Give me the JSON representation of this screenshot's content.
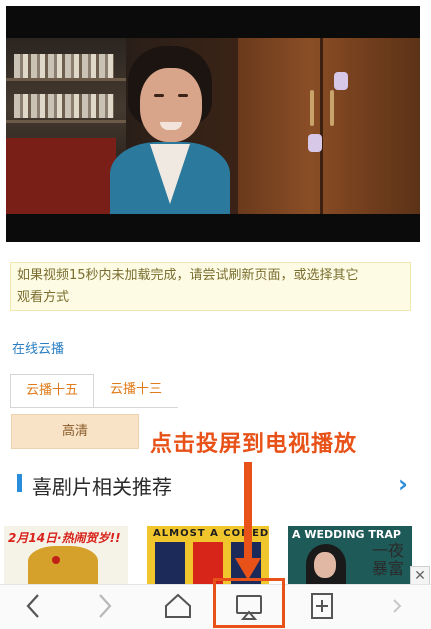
{
  "notice": {
    "line1": "如果视频15秒内未加载完成，请尝试刷新页面，或选择其它",
    "line2": "观看方式"
  },
  "cloud": {
    "title": "在线云播",
    "tabs": [
      "云播十五",
      "云播十三"
    ],
    "quality": "高清"
  },
  "annotation": "点击投屏到电视播放",
  "recommend": {
    "title": "喜剧片相关推荐",
    "posters": [
      {
        "text": "2月14日·热闹贺岁!!"
      },
      {
        "text": "ALMOST A COMEDY"
      },
      {
        "text": "A WEDDING TRAP",
        "calligraphy": "一夜暴富"
      }
    ]
  },
  "ad": {
    "close": "✕"
  },
  "bottom_nav": {
    "items": [
      "back-icon",
      "forward-icon",
      "home-icon",
      "cast-screen-icon",
      "bookmark-add-icon",
      "more-icon"
    ]
  },
  "colors": {
    "accent": "#2a8ddc",
    "annotation": "#e85218",
    "tab_text": "#e07b1a",
    "notice_bg": "#fdfbe3"
  }
}
